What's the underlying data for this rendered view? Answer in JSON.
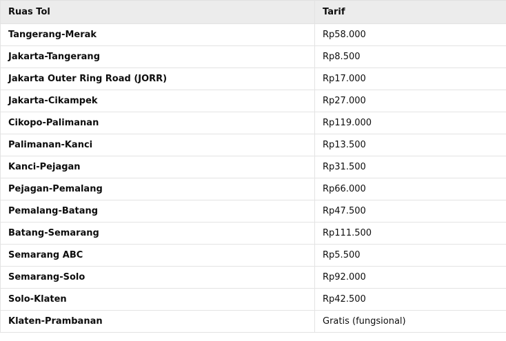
{
  "table": {
    "headers": [
      "Ruas Tol",
      "Tarif"
    ],
    "rows": [
      [
        "Tangerang-Merak",
        "Rp58.000"
      ],
      [
        "Jakarta-Tangerang",
        "Rp8.500"
      ],
      [
        "Jakarta Outer Ring Road (JORR)",
        "Rp17.000"
      ],
      [
        "Jakarta-Cikampek",
        "Rp27.000"
      ],
      [
        "Cikopo-Palimanan",
        "Rp119.000"
      ],
      [
        "Palimanan-Kanci",
        "Rp13.500"
      ],
      [
        "Kanci-Pejagan",
        "Rp31.500"
      ],
      [
        "Pejagan-Pemalang",
        "Rp66.000"
      ],
      [
        "Pemalang-Batang",
        "Rp47.500"
      ],
      [
        "Batang-Semarang",
        "Rp111.500"
      ],
      [
        "Semarang ABC",
        "Rp5.500"
      ],
      [
        "Semarang-Solo",
        "Rp92.000"
      ],
      [
        "Solo-Klaten",
        "Rp42.500"
      ],
      [
        "Klaten-Prambanan",
        "Gratis (fungsional)"
      ]
    ]
  }
}
